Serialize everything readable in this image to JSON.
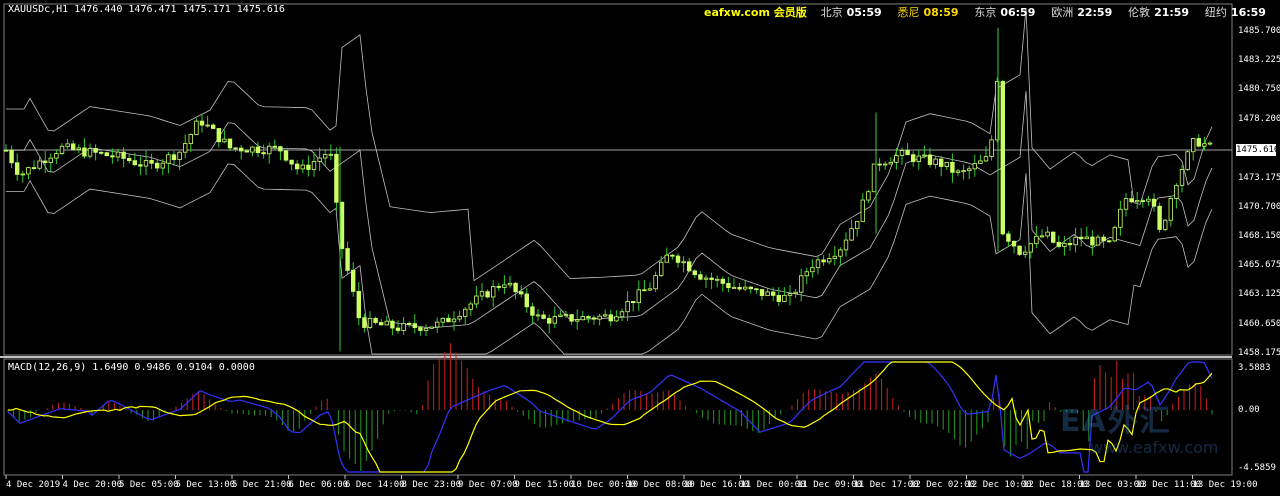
{
  "chart": {
    "symbol_info": "XAUUSDc,H1  1476.440 1476.471 1475.171 1475.616",
    "current_price_label": "1475.616",
    "current_price": 1475.616,
    "price_axis": [
      "1485.700",
      "1483.225",
      "1480.750",
      "1478.200",
      "1475.616",
      "1473.175",
      "1470.700",
      "1468.150",
      "1465.675",
      "1463.125",
      "1460.650",
      "1458.175"
    ],
    "macd_label": "MACD(12,26,9) 1.6490 0.9486 0.9104 0.0000",
    "macd_axis": [
      "3.5883",
      "0.00",
      "-4.5859"
    ],
    "time_axis": [
      "4 Dec 2019",
      "4 Dec 20:00",
      "5 Dec 05:00",
      "5 Dec 13:00",
      "5 Dec 21:00",
      "6 Dec 06:00",
      "6 Dec 14:00",
      "8 Dec 23:00",
      "9 Dec 07:00",
      "9 Dec 15:00",
      "10 Dec 00:00",
      "10 Dec 08:00",
      "10 Dec 16:00",
      "11 Dec 00:00",
      "11 Dec 09:00",
      "11 Dec 17:00",
      "12 Dec 02:00",
      "12 Dec 10:00",
      "12 Dec 18:00",
      "13 Dec 03:00",
      "13 Dec 11:00",
      "13 Dec 19:00"
    ],
    "colors": {
      "bg": "#000000",
      "candle": "#ccff66",
      "wick": "#33cc33",
      "bands": "#c0c0c0",
      "macd_main": "#3333ff",
      "macd_signal": "#ffff00",
      "hist_pos": "#cc2222",
      "hist_neg": "#229922",
      "grid": "#808080"
    }
  },
  "header": {
    "site": "eafxw.com 会员版",
    "clocks": [
      {
        "city": "北京",
        "time": "05:59",
        "highlight": false
      },
      {
        "city": "悉尼",
        "time": "08:59",
        "highlight": true
      },
      {
        "city": "东京",
        "time": "06:59",
        "highlight": false
      },
      {
        "city": "欧洲",
        "time": "22:59",
        "highlight": false
      },
      {
        "city": "伦敦",
        "time": "21:59",
        "highlight": false
      },
      {
        "city": "纽约",
        "time": "16:59",
        "highlight": false
      }
    ]
  },
  "watermark": {
    "main": "EA外汇",
    "sub": "www.eafxw.com"
  }
}
